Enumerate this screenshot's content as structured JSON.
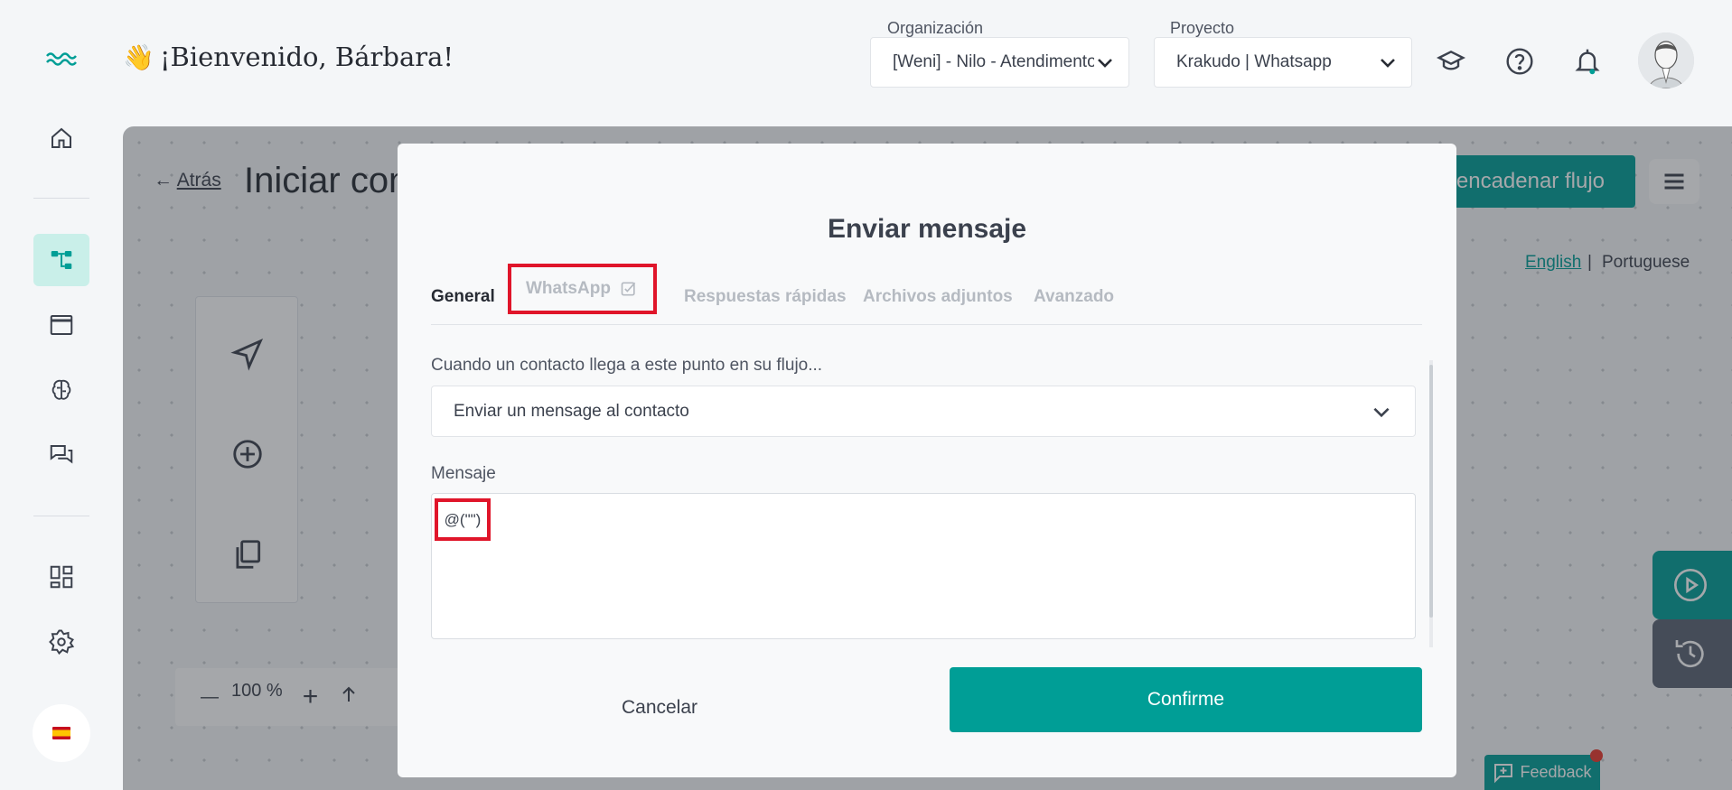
{
  "header": {
    "greeting": "¡Bienvenido, Bárbara!",
    "org_label": "Organización",
    "org_value": "[Weni] - Nilo - Atendimento",
    "project_label": "Proyecto",
    "project_value": "Krakudo | Whatsapp"
  },
  "sidebar": {
    "items": [
      "home-icon",
      "flows-icon",
      "window-icon",
      "brain-icon",
      "chat-icon",
      "dashboard-icon",
      "settings-icon"
    ],
    "active": "flows-icon",
    "language": "es"
  },
  "page": {
    "back_arrow": "←",
    "back_label": "Atrás",
    "title": "Iniciar con",
    "action_button": "encadenar flujo",
    "lang_english": "English",
    "lang_separator": "|",
    "lang_portuguese": "Portuguese",
    "zoom_value": "100 %",
    "zoom_minus": "—",
    "zoom_plus": "+",
    "feedback_label": "Feedback"
  },
  "modal": {
    "title": "Enviar mensaje",
    "tabs": {
      "general": "General",
      "whatsapp": "WhatsApp",
      "quick_replies": "Respuestas rápidas",
      "attachments": "Archivos adjuntos",
      "advanced": "Avanzado"
    },
    "action_label": "Cuando un contacto llega a este punto en su flujo...",
    "action_value": "Enviar un mensage al contacto",
    "message_label": "Mensaje",
    "message_value": "@(\"\")",
    "cancel_label": "Cancelar",
    "confirm_label": "Confirme"
  },
  "colors": {
    "primary": "#009e96",
    "highlight": "#e0152a",
    "active_nav_bg": "#c9efe9"
  }
}
